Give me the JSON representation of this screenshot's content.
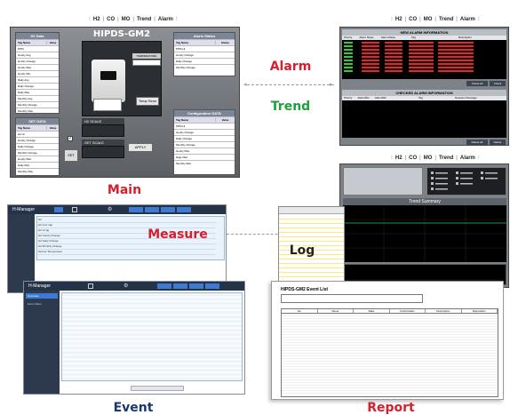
{
  "main_screen": {
    "nav": [
      "H2",
      "CO",
      "MO",
      "Trend",
      "Alarm"
    ],
    "title": "HIPDS-GM2",
    "h2_data": {
      "title": "H2 Data",
      "col_tag": "Tag Name",
      "col_value": "Value",
      "rows": [
        "PPM",
        "Hourly Avg",
        "Hourly Change",
        "Hourly Max",
        "Hourly Min",
        "Daily Avg",
        "Daily Change",
        "Daily Max",
        "Monthly Avg",
        "Monthly Change",
        "Monthly Max"
      ]
    },
    "set_data": {
      "title": "SET DATA",
      "col_tag": "Tag Name",
      "col_value": "Value",
      "rows": [
        "H2 Hi",
        "Hourly Change",
        "Daily Change",
        "Monthly Change",
        "Hourly Max",
        "Daily Max",
        "Monthly Max"
      ],
      "set_button": "SET"
    },
    "temperature_label": "TEMPERATURE",
    "temp_button": "Temp Sens",
    "h2_scale": "H2 SCALE",
    "set_scale": "SET SCALE",
    "apply_button": "APPLY",
    "alarm_status": {
      "title": "Alarm Status",
      "col_tag": "Tag Name",
      "col_status": "Status",
      "rows": [
        "PPM Hi",
        "Hourly Change",
        "Daily Change",
        "Monthly Change"
      ]
    },
    "configuration": {
      "title": "Configuration DATA",
      "col_tag": "Tag Name",
      "col_value": "Value",
      "rows": [
        "PPM Hi",
        "Hourly Change",
        "Daily Change",
        "Monthly Change",
        "Hourly Max",
        "Daily Max",
        "Monthly Max"
      ]
    }
  },
  "alarm_screen": {
    "nav": [
      "H2",
      "CO",
      "MO",
      "Trend",
      "Alarm"
    ],
    "new_title": "NEW ALARM INFORMATION",
    "new_cols": [
      "Priority",
      "Alarm Raise",
      "Alarm Raise",
      "Tag",
      "Description"
    ],
    "check_all": "Check All",
    "check": "Check",
    "checked_title": "CHECKED ALARM INFORMATION",
    "checked_cols": [
      "Priority",
      "Alarm/Rtn",
      "Alarm/Rtn",
      "Tag",
      "Operator Message"
    ],
    "delete_all": "Delete All",
    "delete": "Delete"
  },
  "trend_screen": {
    "nav": [
      "H2",
      "CO",
      "MO",
      "Trend",
      "Alarm"
    ],
    "summary_title": "Trend Summary"
  },
  "measure_screen": {
    "app": "H-Manager",
    "rows": [
      "H2",
      "H2 (Cor sig)",
      "H2 Hi sig",
      "H2 Hourly Change",
      "H2 Daily Change",
      "H2 Monthly Change",
      "Sensor Temperature"
    ]
  },
  "event_screen": {
    "app": "H-Manager",
    "sidebar": [
      "Overview",
      "Event Alarm"
    ]
  },
  "report_screen": {
    "title": "HIPDS-GM2 Event List",
    "cols": [
      "No",
      "Name",
      "Data",
      "Confirmation",
      "Description",
      "Disposition"
    ]
  },
  "captions": {
    "alarm": "Alarm",
    "trend": "Trend",
    "main": "Main",
    "measure": "Measure",
    "log": "Log",
    "event": "Event",
    "report": "Report"
  }
}
